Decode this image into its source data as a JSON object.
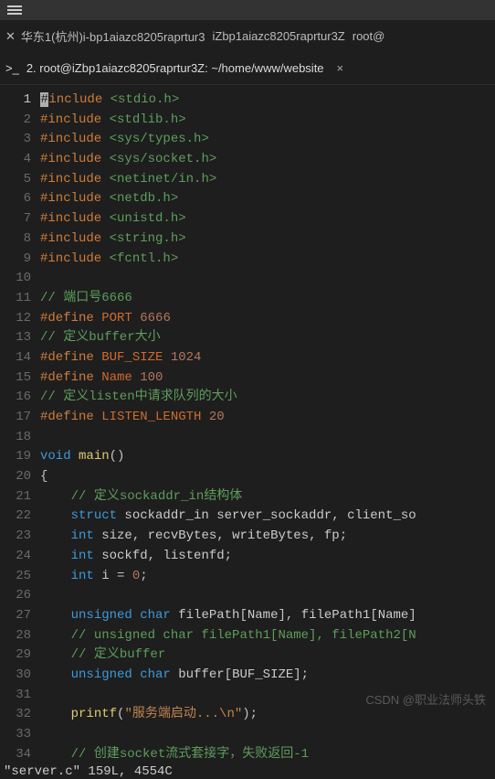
{
  "topbar": {
    "title": ""
  },
  "tabs": {
    "row1": [
      {
        "icon": "✕",
        "label": "华东1(杭州)i-bp1aiazc8205raprtur3"
      },
      {
        "label": "iZbp1aiazc8205raprtur3Z"
      },
      {
        "label": "root@"
      }
    ],
    "inner": {
      "icon": ">_",
      "label": "2. root@iZbp1aiazc8205raprtur3Z: ~/home/www/website",
      "close": "×"
    }
  },
  "code": {
    "1": [
      [
        "preproc",
        "#"
      ],
      [
        "preproc",
        "include "
      ],
      [
        "string",
        "<stdio.h>"
      ]
    ],
    "2": [
      [
        "preproc",
        "#include "
      ],
      [
        "string",
        "<stdlib.h>"
      ]
    ],
    "3": [
      [
        "preproc",
        "#include "
      ],
      [
        "string",
        "<sys/types.h>"
      ]
    ],
    "4": [
      [
        "preproc",
        "#include "
      ],
      [
        "string",
        "<sys/socket.h>"
      ]
    ],
    "5": [
      [
        "preproc",
        "#include "
      ],
      [
        "string",
        "<netinet/in.h>"
      ]
    ],
    "6": [
      [
        "preproc",
        "#include "
      ],
      [
        "string",
        "<netdb.h>"
      ]
    ],
    "7": [
      [
        "preproc",
        "#include "
      ],
      [
        "string",
        "<unistd.h>"
      ]
    ],
    "8": [
      [
        "preproc",
        "#include "
      ],
      [
        "string",
        "<string.h>"
      ]
    ],
    "9": [
      [
        "preproc",
        "#include "
      ],
      [
        "string",
        "<fcntl.h>"
      ]
    ],
    "10": [],
    "11": [
      [
        "comment",
        "// 端口号6666"
      ]
    ],
    "12": [
      [
        "preproc",
        "#define "
      ],
      [
        "define",
        "PORT "
      ],
      [
        "number",
        "6666"
      ]
    ],
    "13": [
      [
        "comment",
        "// 定义buffer大小"
      ]
    ],
    "14": [
      [
        "preproc",
        "#define "
      ],
      [
        "define",
        "BUF_SIZE "
      ],
      [
        "number",
        "1024"
      ]
    ],
    "15": [
      [
        "preproc",
        "#define "
      ],
      [
        "define",
        "Name "
      ],
      [
        "number",
        "100"
      ]
    ],
    "16": [
      [
        "comment",
        "// 定义listen中请求队列的大小"
      ]
    ],
    "17": [
      [
        "preproc",
        "#define "
      ],
      [
        "define",
        "LISTEN_LENGTH "
      ],
      [
        "number",
        "20"
      ]
    ],
    "18": [],
    "19": [
      [
        "type",
        "void "
      ],
      [
        "func",
        "main"
      ],
      [
        "punct",
        "()"
      ]
    ],
    "20": [
      [
        "punct",
        "{"
      ]
    ],
    "21": [
      [
        "plain",
        "    "
      ],
      [
        "comment",
        "// 定义sockaddr_in结构体"
      ]
    ],
    "22": [
      [
        "plain",
        "    "
      ],
      [
        "type",
        "struct "
      ],
      [
        "var",
        "sockaddr_in server_sockaddr"
      ],
      [
        "punct",
        ", "
      ],
      [
        "var",
        "client_so"
      ]
    ],
    "23": [
      [
        "plain",
        "    "
      ],
      [
        "type",
        "int "
      ],
      [
        "var",
        "size"
      ],
      [
        "punct",
        ", "
      ],
      [
        "var",
        "recvBytes"
      ],
      [
        "punct",
        ", "
      ],
      [
        "var",
        "writeBytes"
      ],
      [
        "punct",
        ", "
      ],
      [
        "var",
        "fp"
      ],
      [
        "punct",
        ";"
      ]
    ],
    "24": [
      [
        "plain",
        "    "
      ],
      [
        "type",
        "int "
      ],
      [
        "var",
        "sockfd"
      ],
      [
        "punct",
        ", "
      ],
      [
        "var",
        "listenfd"
      ],
      [
        "punct",
        ";"
      ]
    ],
    "25": [
      [
        "plain",
        "    "
      ],
      [
        "type",
        "int "
      ],
      [
        "var",
        "i "
      ],
      [
        "punct",
        "= "
      ],
      [
        "number",
        "0"
      ],
      [
        "punct",
        ";"
      ]
    ],
    "26": [],
    "27": [
      [
        "plain",
        "    "
      ],
      [
        "type",
        "unsigned char "
      ],
      [
        "var",
        "filePath"
      ],
      [
        "punct",
        "["
      ],
      [
        "var",
        "Name"
      ],
      [
        "punct",
        "], "
      ],
      [
        "var",
        "filePath1"
      ],
      [
        "punct",
        "["
      ],
      [
        "var",
        "Name"
      ],
      [
        "punct",
        "]"
      ]
    ],
    "28": [
      [
        "plain",
        "    "
      ],
      [
        "comment",
        "// unsigned char filePath1[Name], filePath2[N"
      ]
    ],
    "29": [
      [
        "plain",
        "    "
      ],
      [
        "comment",
        "// 定义buffer"
      ]
    ],
    "30": [
      [
        "plain",
        "    "
      ],
      [
        "type",
        "unsigned char "
      ],
      [
        "var",
        "buffer"
      ],
      [
        "punct",
        "["
      ],
      [
        "var",
        "BUF_SIZE"
      ],
      [
        "punct",
        "];"
      ]
    ],
    "31": [],
    "32": [
      [
        "plain",
        "    "
      ],
      [
        "func",
        "printf"
      ],
      [
        "punct",
        "("
      ],
      [
        "quoted",
        "\"服务端启动...\\n\""
      ],
      [
        "punct",
        ");"
      ]
    ],
    "33": [],
    "34": [
      [
        "plain",
        "    "
      ],
      [
        "comment",
        "// 创建socket流式套接字，失败返回-1"
      ]
    ]
  },
  "status": "\"server.c\" 159L, 4554C",
  "watermark": "CSDN @职业法师头铁"
}
